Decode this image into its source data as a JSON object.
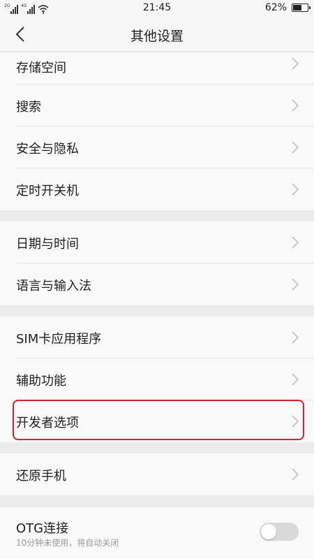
{
  "status_bar": {
    "sim1_net": "2G",
    "sim2_net": "4G",
    "time": "21:45",
    "battery": "62%",
    "battery_level": 0.62
  },
  "header": {
    "title": "其他设置",
    "back_icon": "chevron-left-icon"
  },
  "settings": {
    "storage": "存储空间",
    "search": "搜索",
    "security_privacy": "安全与隐私",
    "scheduled_power": "定时开关机",
    "date_time": "日期与时间",
    "language_input": "语言与输入法",
    "sim_apps": "SIM卡应用程序",
    "accessibility": "辅助功能",
    "developer_options": "开发者选项",
    "reset_phone": "还原手机",
    "otg": {
      "label": "OTG连接",
      "subtitle": "10分钟未使用，将自动关闭",
      "enabled": false
    }
  },
  "colors": {
    "highlight": "#d81e2c",
    "background": "#ececec",
    "row": "#f9f9f9"
  }
}
